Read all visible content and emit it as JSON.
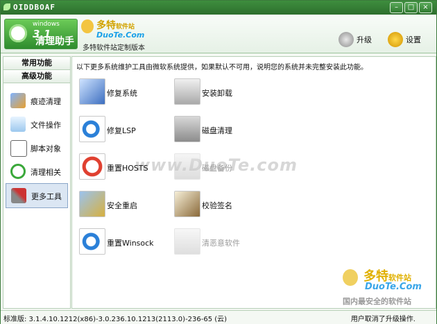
{
  "window": {
    "title": "OIDDBOAF"
  },
  "header": {
    "logo": {
      "os": "windows",
      "version": "3.1",
      "name": "清理助手"
    },
    "partner": {
      "name": "多特",
      "name_small": "软件站",
      "url": "DuoTe.Com",
      "caption": "多特软件站定制版本"
    },
    "upgrade_label": "升级",
    "settings_label": "设置"
  },
  "sidebar": {
    "tabs": [
      {
        "label": "常用功能"
      },
      {
        "label": "高级功能"
      }
    ],
    "items": [
      {
        "label": "痕迹清理",
        "icon": "broom-icon"
      },
      {
        "label": "文件操作",
        "icon": "folder-icon"
      },
      {
        "label": "脚本对象",
        "icon": "script-icon"
      },
      {
        "label": "清理相关",
        "icon": "refresh-icon"
      },
      {
        "label": "更多工具",
        "icon": "tools-icon",
        "active": true
      }
    ]
  },
  "main": {
    "intro": "以下更多系统维护工具由微软系统提供，如果默认不可用，说明您的系统并未完整安装此功能。",
    "tools": [
      {
        "label": "修复系统",
        "icon": "windows-repair-icon",
        "enabled": true
      },
      {
        "label": "安装卸载",
        "icon": "install-uninstall-icon",
        "enabled": true
      },
      {
        "label": "修复LSP",
        "icon": "ie-repair-icon",
        "enabled": true
      },
      {
        "label": "磁盘清理",
        "icon": "disk-cleanup-icon",
        "enabled": true
      },
      {
        "label": "重置HOSTS",
        "icon": "hosts-reset-icon",
        "enabled": true
      },
      {
        "label": "磁盘备份",
        "icon": "disk-backup-icon",
        "enabled": false
      },
      {
        "label": "安全重启",
        "icon": "safe-restart-icon",
        "enabled": true
      },
      {
        "label": "校验签名",
        "icon": "signature-icon",
        "enabled": true
      },
      {
        "label": "重置Winsock",
        "icon": "winsock-reset-icon",
        "enabled": true
      },
      {
        "label": "清恶意软件",
        "icon": "malware-icon",
        "enabled": false
      }
    ],
    "watermark": "www.DuoTe.com"
  },
  "bottom_logo": {
    "name": "多特",
    "name_small": "软件站",
    "url": "DuoTe.Com",
    "slogan": "国内最安全的软件站"
  },
  "statusbar": {
    "version": "标准版: 3.1.4.10.1212(x86)-3.0.236.10.1213(2113.0)-236-65 (云)",
    "message": "用户取消了升级操作."
  }
}
